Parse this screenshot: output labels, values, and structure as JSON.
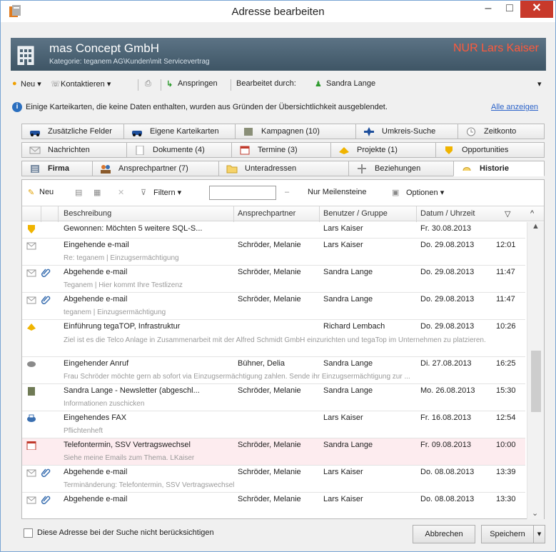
{
  "window": {
    "title": "Adresse bearbeiten",
    "min_glyph": "–",
    "max_glyph": "□",
    "close_glyph": "✕"
  },
  "header": {
    "company": "mas Concept GmbH",
    "category": "Kategorie: teganem AG\\Kunden\\mit Servicevertrag",
    "owner": "NUR Lars Kaiser"
  },
  "toolbar": {
    "new": "Neu ▾",
    "contact": "Kontaktieren ▾",
    "jump": "Anspringen",
    "edited_by_label": "Bearbeitet durch:",
    "edited_by_user": "Sandra Lange",
    "overflow": "▾"
  },
  "info": {
    "text": "Einige Karteikarten, die keine Daten enthalten, wurden aus Gründen der Übersichtlichkeit ausgeblendet.",
    "link": "Alle anzeigen"
  },
  "tabs": {
    "row1": [
      "Zusätzliche Felder",
      "Eigene Karteikarten",
      "Kampagnen (10)",
      "Umkreis-Suche",
      "Zeitkonto"
    ],
    "row2": [
      "Nachrichten",
      "Dokumente (4)",
      "Termine (3)",
      "Projekte (1)",
      "Opportunities"
    ],
    "row3": [
      "Firma",
      "Ansprechpartner (7)",
      "Unteradressen",
      "Beziehungen",
      "Historie"
    ]
  },
  "grid_toolbar": {
    "new": "Neu",
    "filter": "Filtern ▾",
    "filter_value": "",
    "milestones": "Nur Meilensteine",
    "options": "Optionen ▾",
    "dash": "–"
  },
  "columns": {
    "description": "Beschreibung",
    "contact": "Ansprechpartner",
    "user": "Benutzer / Gruppe",
    "date": "Datum / Uhrzeit",
    "sort": "▽",
    "up": "^"
  },
  "rows": [
    {
      "icon": "trophy-icon",
      "desc": "Gewonnen: Möchten 5 weitere SQL-S...",
      "contact": "",
      "user": "Lars Kaiser",
      "date": "Fr.  30.08.2013",
      "time": "",
      "sub": ""
    },
    {
      "icon": "email-in-icon",
      "desc": "Eingehende e-mail",
      "contact": "Schröder, Melanie",
      "user": "Lars Kaiser",
      "date": "Do.  29.08.2013",
      "time": "12:01",
      "sub": "Re: teganem | Einzugsermächtigung"
    },
    {
      "icon": "email-out-icon",
      "desc": "Abgehende e-mail",
      "contact": "Schröder, Melanie",
      "user": "Sandra Lange",
      "date": "Do.  29.08.2013",
      "time": "11:47",
      "sub": "Teganem | Hier kommt Ihre Testlizenz"
    },
    {
      "icon": "email-out-icon",
      "desc": "Abgehende e-mail",
      "contact": "Schröder, Melanie",
      "user": "Sandra Lange",
      "date": "Do.  29.08.2013",
      "time": "11:47",
      "sub": "teganem | Einzugsermächtigung"
    },
    {
      "icon": "project-icon",
      "desc": "Einführung tegaTOP, Infrastruktur",
      "contact": "",
      "user": "Richard Lembach",
      "date": "Do.  29.08.2013",
      "time": "10:26",
      "sub": "Ziel ist es die Telco Anlage in Zusammenarbeit mit der Alfred Schmidt GmbH einzurichten und tegaTop im Unternehmen zu platzieren."
    },
    {
      "icon": "phone-call-icon",
      "desc": "Eingehender Anruf",
      "contact": "Bühner, Delia",
      "user": "Sandra Lange",
      "date": "Di.  27.08.2013",
      "time": "16:25",
      "sub": "Frau Schröder möchte gern ab sofort via Einzugsermächtigung zahlen. Sende ihr Einzugsermächtigung zur ..."
    },
    {
      "icon": "newsletter-icon",
      "desc": "Sandra Lange - Newsletter (abgeschl...",
      "contact": "Schröder, Melanie",
      "user": "Sandra Lange",
      "date": "Mo.  26.08.2013",
      "time": "15:30",
      "sub": "Informationen zuschicken"
    },
    {
      "icon": "fax-icon",
      "desc": "Eingehendes FAX",
      "contact": "",
      "user": "Lars Kaiser",
      "date": "Fr.  16.08.2013",
      "time": "12:54",
      "sub": "Pflichtenheft"
    },
    {
      "icon": "calendar-icon",
      "desc": "Telefontermin, SSV Vertragswechsel",
      "contact": "Schröder, Melanie",
      "user": "Sandra Lange",
      "date": "Fr.  09.08.2013",
      "time": "10:00",
      "sub": "Siehe meine Emails zum Thema. LKaiser"
    },
    {
      "icon": "email-out-icon",
      "desc": "Abgehende e-mail",
      "contact": "Schröder, Melanie",
      "user": "Lars Kaiser",
      "date": "Do.  08.08.2013",
      "time": "13:39",
      "sub": "Terminänderung: Telefontermin, SSV Vertragswechsel"
    },
    {
      "icon": "email-out-icon",
      "desc": "Abgehende e-mail",
      "contact": "Schröder, Melanie",
      "user": "Lars Kaiser",
      "date": "Do.  08.08.2013",
      "time": "13:30",
      "sub": ""
    }
  ],
  "footer": {
    "ignore_label": "Diese Adresse bei der Suche nicht berücksichtigen",
    "cancel": "Abbrechen",
    "save": "Speichern",
    "save_dropdown": "▾"
  },
  "colors": {
    "header_bg": "#4d6474",
    "owner_red": "#ff5a3c",
    "close_red": "#c8392b",
    "link_blue": "#2a62c9",
    "selected_row": "#fdecef"
  }
}
